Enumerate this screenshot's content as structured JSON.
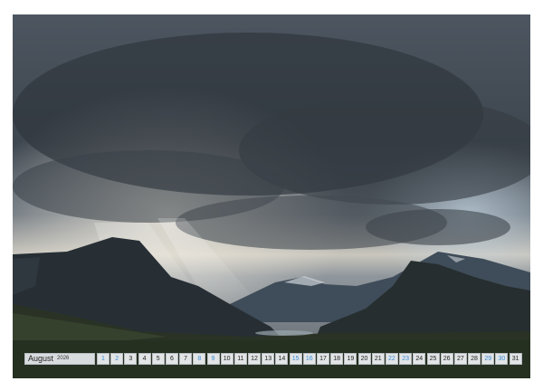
{
  "calendar": {
    "month": "August",
    "year": "2026",
    "days": [
      {
        "n": "1",
        "weekend": true
      },
      {
        "n": "2",
        "weekend": true
      },
      {
        "n": "3",
        "weekend": false
      },
      {
        "n": "4",
        "weekend": false
      },
      {
        "n": "5",
        "weekend": false
      },
      {
        "n": "6",
        "weekend": false
      },
      {
        "n": "7",
        "weekend": false
      },
      {
        "n": "8",
        "weekend": true
      },
      {
        "n": "9",
        "weekend": true
      },
      {
        "n": "10",
        "weekend": false
      },
      {
        "n": "11",
        "weekend": false
      },
      {
        "n": "12",
        "weekend": false
      },
      {
        "n": "13",
        "weekend": false
      },
      {
        "n": "14",
        "weekend": false
      },
      {
        "n": "15",
        "weekend": true
      },
      {
        "n": "16",
        "weekend": true
      },
      {
        "n": "17",
        "weekend": false
      },
      {
        "n": "18",
        "weekend": false
      },
      {
        "n": "19",
        "weekend": false
      },
      {
        "n": "20",
        "weekend": false
      },
      {
        "n": "21",
        "weekend": false
      },
      {
        "n": "22",
        "weekend": true
      },
      {
        "n": "23",
        "weekend": true
      },
      {
        "n": "24",
        "weekend": false
      },
      {
        "n": "25",
        "weekend": false
      },
      {
        "n": "26",
        "weekend": false
      },
      {
        "n": "27",
        "weekend": false
      },
      {
        "n": "28",
        "weekend": false
      },
      {
        "n": "29",
        "weekend": true
      },
      {
        "n": "30",
        "weekend": true
      },
      {
        "n": "31",
        "weekend": false
      }
    ]
  },
  "colors": {
    "weekend": "#3b8fd6",
    "cell_bg": "#e2e4e6",
    "binding": "#9a9a9a"
  }
}
